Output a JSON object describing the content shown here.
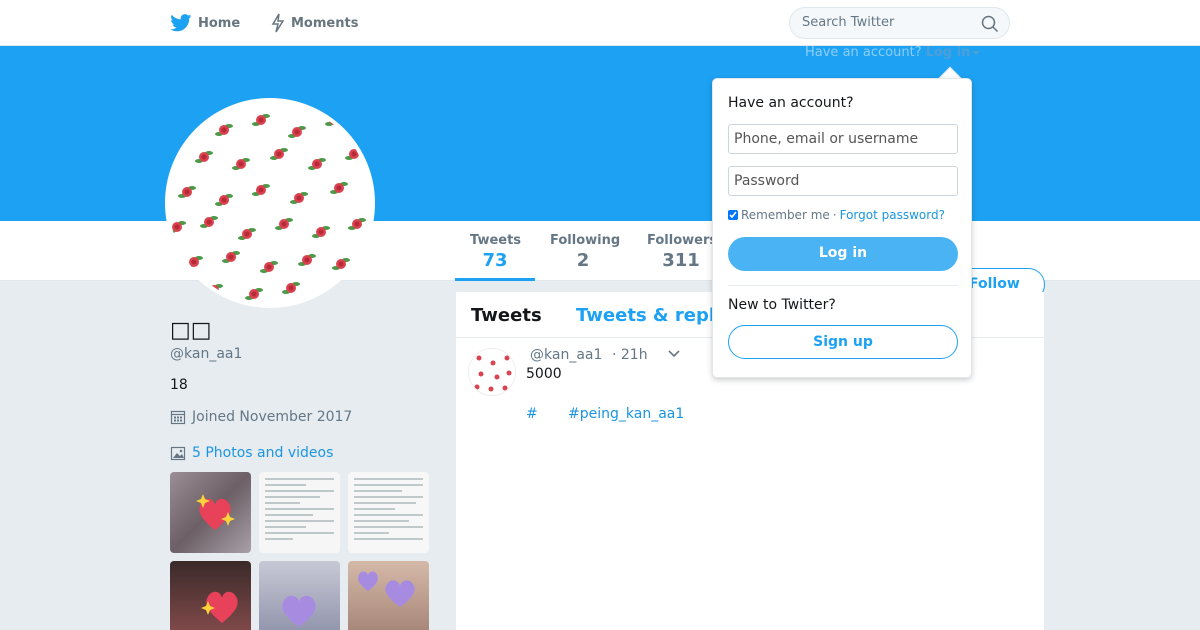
{
  "nav": {
    "home_label": "Home",
    "moments_label": "Moments",
    "search_placeholder": "Search Twitter"
  },
  "header": {
    "have_account": "Have an account?",
    "login_link": "Log in"
  },
  "stats": {
    "tweets_label": "Tweets",
    "tweets_value": "73",
    "following_label": "Following",
    "following_value": "2",
    "followers_label": "Followers",
    "followers_value": "311"
  },
  "follow_button": "Follow",
  "profile": {
    "name": "□□",
    "handle": "@kan_aa1",
    "bio": "18",
    "joined": "Joined November 2017",
    "photos_link": "5 Photos and videos"
  },
  "timeline": {
    "tab_tweets": "Tweets",
    "tab_replies": "Tweets & replies",
    "tweet": {
      "handle": "@kan_aa1",
      "time": "· 21h",
      "text": "5000",
      "hashtag1": "#",
      "hashtag2": "#peing_kan_aa1"
    }
  },
  "login_dropdown": {
    "title": "Have an account?",
    "username_placeholder": "Phone, email or username",
    "password_placeholder": "Password",
    "remember_me": "Remember me",
    "separator": "·",
    "forgot_password": "Forgot password?",
    "login_button": "Log in",
    "new_to_twitter": "New to Twitter?",
    "signup_button": "Sign up"
  },
  "colors": {
    "brand_blue": "#1da1f2",
    "link_blue": "#1b95e0",
    "page_bg": "#e6ecf0"
  }
}
